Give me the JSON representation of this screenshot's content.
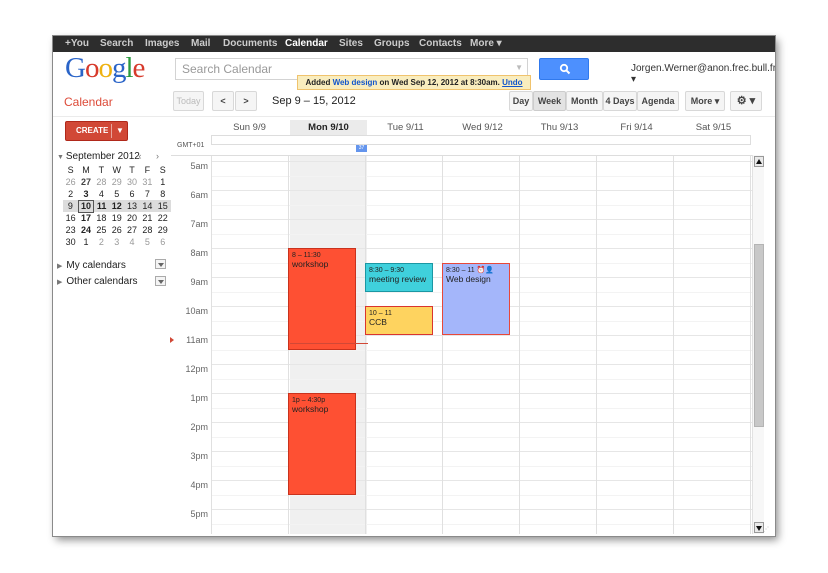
{
  "topnav": [
    {
      "label": "+You"
    },
    {
      "label": "Search"
    },
    {
      "label": "Images"
    },
    {
      "label": "Mail"
    },
    {
      "label": "Documents"
    },
    {
      "label": "Calendar"
    },
    {
      "label": "Sites"
    },
    {
      "label": "Groups"
    },
    {
      "label": "Contacts"
    },
    {
      "label": "More ▾"
    }
  ],
  "logo": {
    "l1": "G",
    "l2": "o",
    "l3": "o",
    "l4": "g",
    "l5": "l",
    "l6": "e"
  },
  "search": {
    "placeholder": "Search Calendar"
  },
  "user": {
    "email": "Jorgen.Werner@anon.frec.bull.fr ▾"
  },
  "toast": {
    "prefix": "Added ",
    "event": "Web design",
    "middle": " on Wed Sep 12, 2012 at 8:30am. ",
    "undo": "Undo"
  },
  "app": {
    "title": "Calendar"
  },
  "toolbar": {
    "today": "Today",
    "prev": "<",
    "next": ">",
    "range": "Sep 9 – 15, 2012",
    "views": {
      "day": "Day",
      "week": "Week",
      "month": "Month",
      "four_days": "4 Days",
      "agenda": "Agenda",
      "more": "More ▾"
    },
    "settings": "⚙ ▾"
  },
  "sidebar": {
    "create_label": "CREATE",
    "create_arrow": "▼",
    "mini_title": "September 2012",
    "mini_nav": "‹ ›",
    "weekdays": [
      "S",
      "M",
      "T",
      "W",
      "T",
      "F",
      "S"
    ],
    "weeks": [
      [
        "26",
        "27",
        "28",
        "29",
        "30",
        "31",
        "1"
      ],
      [
        "2",
        "3",
        "4",
        "5",
        "6",
        "7",
        "8"
      ],
      [
        "9",
        "10",
        "11",
        "12",
        "13",
        "14",
        "15"
      ],
      [
        "16",
        "17",
        "18",
        "19",
        "20",
        "21",
        "22"
      ],
      [
        "23",
        "24",
        "25",
        "26",
        "27",
        "28",
        "29"
      ],
      [
        "30",
        "1",
        "2",
        "3",
        "4",
        "5",
        "6"
      ]
    ],
    "my_calendars": "My calendars",
    "other_calendars": "Other calendars"
  },
  "week": {
    "days": [
      "Sun 9/9",
      "Mon 9/10",
      "Tue 9/11",
      "Wed 9/12",
      "Thu 9/13",
      "Fri 9/14",
      "Sat 9/15"
    ],
    "timezone": "GMT+01",
    "allday_chip": "37",
    "hours": [
      "5am",
      "6am",
      "7am",
      "8am",
      "9am",
      "10am",
      "11am",
      "12pm",
      "1pm",
      "2pm",
      "3pm",
      "4pm",
      "5pm"
    ]
  },
  "events": [
    {
      "time": "8 – 11:30",
      "title": "workshop",
      "day": 1,
      "start": 8,
      "end": 11.5,
      "color": "#fe5033",
      "border": "#c9321d"
    },
    {
      "time": "8:30 – 9:30",
      "title": "meeting review",
      "day": 2,
      "start": 8.5,
      "end": 9.5,
      "color": "#3fd0dc",
      "border": "#1b97a3"
    },
    {
      "time": "8:30 – 11 ⏰👤",
      "title": "Web design",
      "day": 3,
      "start": 8.5,
      "end": 11,
      "color": "#a4b6fa",
      "border": "#e8483a"
    },
    {
      "time": "10 – 11",
      "title": "CCB",
      "day": 2,
      "start": 10,
      "end": 11,
      "color": "#fed35f",
      "border": "#d9352e"
    },
    {
      "time": "1p – 4:30p",
      "title": "workshop",
      "day": 1,
      "start": 13,
      "end": 16.5,
      "color": "#fe5033",
      "border": "#c9321d"
    }
  ]
}
